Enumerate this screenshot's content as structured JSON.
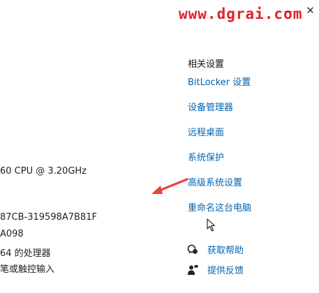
{
  "watermark": "www.dgrai.com",
  "window": {
    "minimize_icon": "minimize-icon",
    "close_glyph": "✕"
  },
  "system_specs": [
    "60  CPU @ 3.20GHz",
    "87CB-319598A7B81F",
    "A098",
    "64 的处理器",
    "笔或触控输入"
  ],
  "related_settings": {
    "title": "相关设置",
    "links": [
      "BitLocker 设置",
      "设备管理器",
      "远程桌面",
      "系统保护",
      "高级系统设置",
      "重命名这台电脑"
    ]
  },
  "help": {
    "get_help": "获取帮助",
    "feedback": "提供反馈"
  },
  "annotation": {
    "arrow_color": "#e8433a"
  },
  "colors": {
    "link": "#0063b1",
    "watermark": "#e0222a"
  }
}
